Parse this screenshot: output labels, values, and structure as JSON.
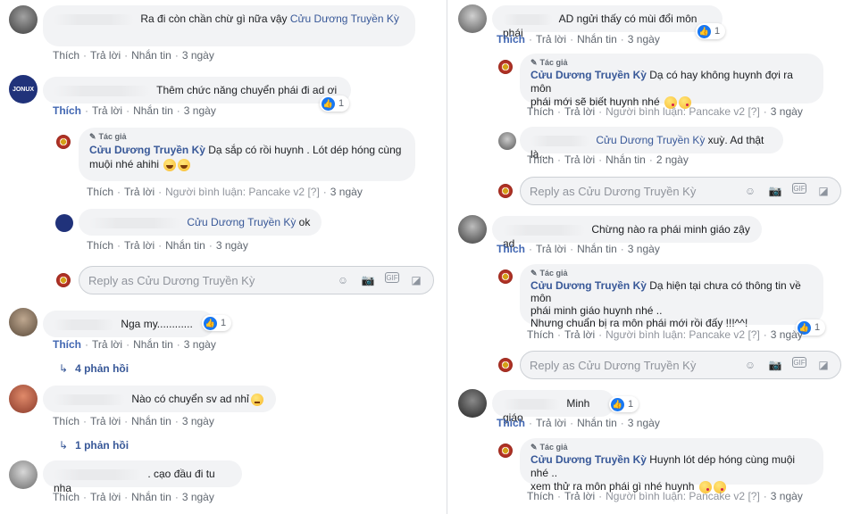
{
  "page": "Cửu Dương Truyền Kỳ",
  "left": [
    {
      "id": "c1",
      "text": "Ra đi còn chần chừ gì nữa vậy",
      "mention": "Cửu Dương Truyền Kỳ",
      "actions": {
        "like": "Thích",
        "reply": "Trả lời",
        "message": "Nhắn tin",
        "time": "3 ngày"
      }
    },
    {
      "id": "c2",
      "text": "Thêm chức năng chuyển phái đi ad ơi",
      "reactions": "1",
      "actions": {
        "like": "Thích",
        "reply": "Trả lời",
        "message": "Nhắn tin",
        "time": "3 ngày"
      },
      "replies": [
        {
          "author_tag": "Tác giả",
          "author": "Cửu Dương Truyền Kỳ",
          "text": "Dạ sắp có rồi huynh . Lót dép hóng cùng muội nhé ahihi",
          "actions": {
            "like": "Thích",
            "reply": "Trả lời",
            "meta": "Người bình luận: Pancake v2",
            "flag": "[?]",
            "time": "3 ngày"
          }
        },
        {
          "mention": "Cửu Dương Truyền Kỳ",
          "text": "ok",
          "actions": {
            "like": "Thích",
            "reply": "Trả lời",
            "message": "Nhắn tin",
            "time": "3 ngày"
          }
        }
      ],
      "reply_placeholder": "Reply as Cửu Dương Truyền Kỳ"
    },
    {
      "id": "c3",
      "text": "Nga my............",
      "reactions": "1",
      "actions": {
        "like": "Thích",
        "reply": "Trả lời",
        "message": "Nhắn tin",
        "time": "3 ngày"
      },
      "replies_link": "4 phản hồi"
    },
    {
      "id": "c4",
      "text": "Nào có chuyển sv ad nhỉ",
      "actions": {
        "like": "Thích",
        "reply": "Trả lời",
        "message": "Nhắn tin",
        "time": "3 ngày"
      },
      "replies_link": "1 phản hồi"
    },
    {
      "id": "c5",
      "text": ". cạo đầu đi tu nha",
      "actions": {
        "like": "Thích",
        "reply": "Trả lời",
        "message": "Nhắn tin",
        "time": "3 ngày"
      }
    }
  ],
  "right": [
    {
      "id": "r1",
      "text": "AD ngửi thấy có mùi đổi môn phái",
      "reactions": "1",
      "actions": {
        "like": "Thích",
        "reply": "Trả lời",
        "message": "Nhắn tin",
        "time": "3 ngày"
      },
      "replies": [
        {
          "author_tag": "Tác giả",
          "author": "Cửu Dương Truyền Kỳ",
          "text_line1": "Dạ có hay không huynh đợi ra môn",
          "text_line2": "phái mới sẽ biết huynh nhé",
          "actions": {
            "like": "Thích",
            "reply": "Trả lời",
            "meta": "Người bình luận: Pancake v2",
            "flag": "[?]",
            "time": "3 ngày"
          }
        },
        {
          "mention": "Cửu Dương Truyền Kỳ",
          "text": "xuỳ. Ad thật là....",
          "actions": {
            "like": "Thích",
            "reply": "Trả lời",
            "message": "Nhắn tin",
            "time": "2 ngày"
          }
        }
      ],
      "reply_placeholder": "Reply as Cửu Dương Truyền Kỳ"
    },
    {
      "id": "r2",
      "text": "Chừng nào ra phái minh giáo zậy ad",
      "actions": {
        "like": "Thích",
        "reply": "Trả lời",
        "message": "Nhắn tin",
        "time": "3 ngày"
      },
      "replies": [
        {
          "author_tag": "Tác giả",
          "author": "Cửu Dương Truyền Kỳ",
          "text_line1": "Dạ hiện tại chưa có thông tin về môn",
          "text_line2": "phái minh giáo huynh nhé ..",
          "text_line3": "Nhưng chuẩn bị ra môn phái mới rồi đấy !!!^^!",
          "reactions": "1",
          "actions": {
            "like": "Thích",
            "reply": "Trả lời",
            "meta": "Người bình luận: Pancake v2",
            "flag": "[?]",
            "time": "3 ngày"
          }
        }
      ],
      "reply_placeholder": "Reply as Cửu Dương Truyền Kỳ"
    },
    {
      "id": "r3",
      "text": "Minh giáo",
      "reactions": "1",
      "actions": {
        "like": "Thích",
        "reply": "Trả lời",
        "message": "Nhắn tin",
        "time": "3 ngày"
      },
      "replies": [
        {
          "author_tag": "Tác giả",
          "author": "Cửu Dương Truyền Kỳ",
          "text_line1": "Huynh lót dép hóng cùng muội nhé ..",
          "text_line2": "xem thử ra môn phái gì nhé huynh",
          "actions": {
            "like": "Thích",
            "reply": "Trả lời",
            "meta": "Người bình luận: Pancake v2",
            "flag": "[?]",
            "time": "3 ngày"
          }
        }
      ]
    }
  ],
  "colors": {
    "link": "#385898",
    "like_active": "#4267b2",
    "bubble": "#f2f3f5",
    "meta": "#606770"
  },
  "icons": [
    "smiley-icon",
    "camera-icon",
    "gif-icon",
    "sticker-icon",
    "like-icon",
    "reply-arrow-icon",
    "pen-icon"
  ]
}
